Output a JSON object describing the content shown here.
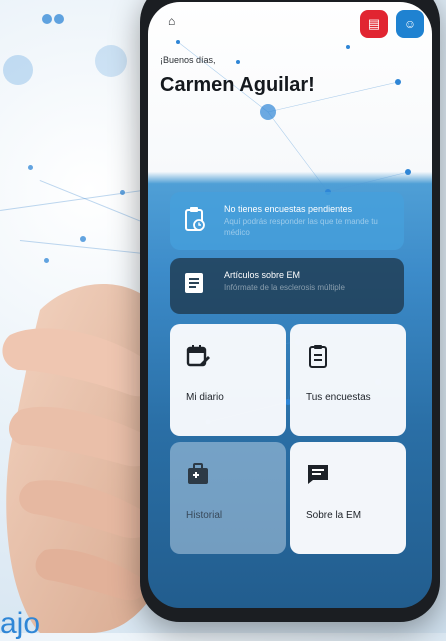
{
  "header": {
    "greeting": "¡Buenos días,",
    "username": "Carmen Aguilar!"
  },
  "icons": {
    "home": "home-icon",
    "chat": "chat-icon",
    "user": "user-icon"
  },
  "banners": [
    {
      "title": "No tienes encuestas pendientes",
      "subtitle": "Aquí podrás responder las que te mande tu médico",
      "icon": "clipboard-clock-icon"
    },
    {
      "title": "Artículos sobre EM",
      "subtitle": "Infórmate de la esclerosis múltiple",
      "icon": "article-icon"
    }
  ],
  "tiles": [
    {
      "label": "Mi diario",
      "icon": "calendar-edit-icon"
    },
    {
      "label": "Tus encuestas",
      "icon": "clipboard-list-icon"
    },
    {
      "label": "Historial",
      "icon": "medical-id-icon"
    },
    {
      "label": "Sobre la EM",
      "icon": "message-icon"
    }
  ],
  "corner_text": "ajo",
  "colors": {
    "chat_button": "#e12531",
    "user_button": "#1f82d1",
    "accent": "#2f86d6"
  }
}
